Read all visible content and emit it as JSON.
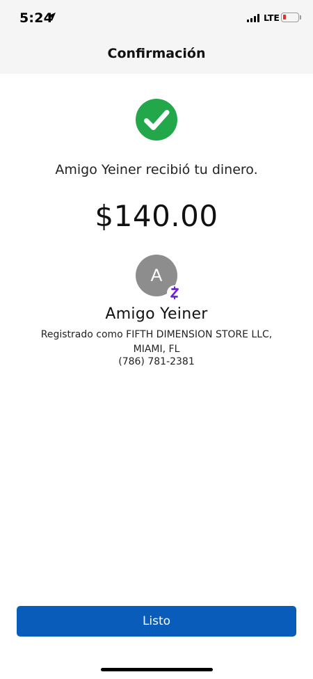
{
  "status_bar": {
    "time": "5:24",
    "network": "LTE",
    "icons": [
      "location-arrow-icon",
      "signal-icon",
      "battery-low-icon"
    ]
  },
  "header": {
    "title": "Confirmación"
  },
  "confirmation": {
    "icon": "check-circle-icon",
    "message": "Amigo  Yeiner recibió tu dinero.",
    "amount": "$140.00"
  },
  "recipient": {
    "avatar_letter": "A",
    "badge_icon": "zelle-icon",
    "name": "Amigo  Yeiner",
    "registered": "Registrado como FIFTH DIMENSION STORE LLC, MIAMI, FL",
    "phone": "(786) 781-2381"
  },
  "actions": {
    "done_label": "Listo"
  },
  "colors": {
    "success_green": "#22a84a",
    "primary_blue": "#0a5cbb",
    "zelle_purple": "#6d1ed4",
    "avatar_gray": "#8d8d8d",
    "header_bg": "#f5f5f6"
  }
}
